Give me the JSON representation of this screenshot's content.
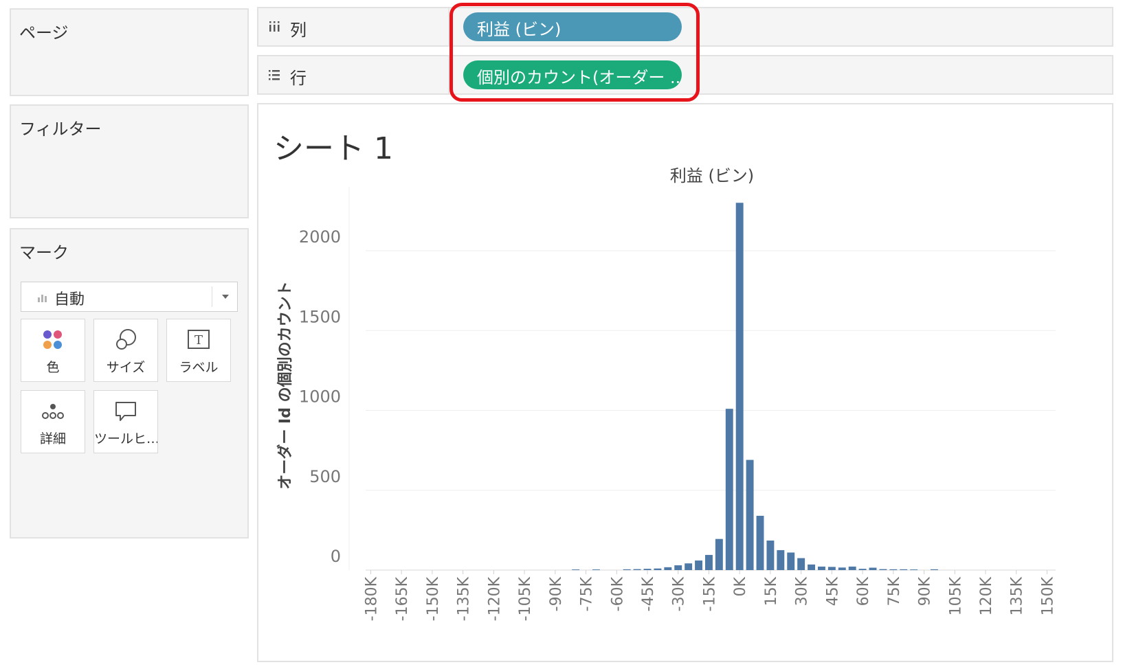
{
  "pages": {
    "title": "ページ"
  },
  "filters": {
    "title": "フィルター"
  },
  "marks": {
    "title": "マーク",
    "mark_type": "自動",
    "cards": [
      {
        "label": "色",
        "icon": "color-dots-icon"
      },
      {
        "label": "サイズ",
        "icon": "size-icon"
      },
      {
        "label": "ラベル",
        "icon": "label-icon"
      },
      {
        "label": "詳細",
        "icon": "detail-icon"
      },
      {
        "label": "ツールヒ…",
        "icon": "tooltip-icon"
      }
    ]
  },
  "shelves": {
    "columns": {
      "label": "列",
      "pill": "利益 (ビン)"
    },
    "rows": {
      "label": "行",
      "pill": "個別のカウント(オーダー .."
    }
  },
  "sheet": {
    "title": "シート 1"
  },
  "colors": {
    "bar": "#4e79a7",
    "column_pill": "#4a98b5",
    "row_pill": "#1bab7a",
    "highlight": "#e8141c"
  },
  "chart_data": {
    "type": "bar",
    "title": "利益 (ビン)",
    "xlabel": "",
    "ylabel": "オーダー Id の個別のカウント",
    "x_ticks": [
      "-180K",
      "-165K",
      "-150K",
      "-135K",
      "-120K",
      "-105K",
      "-90K",
      "-75K",
      "-60K",
      "-45K",
      "-30K",
      "-15K",
      "0K",
      "15K",
      "30K",
      "45K",
      "60K",
      "75K",
      "90K",
      "105K",
      "120K",
      "135K",
      "150K"
    ],
    "y_ticks": [
      0,
      500,
      1000,
      1500,
      2000
    ],
    "ylim": [
      0,
      2400
    ],
    "xlim": [
      -180000,
      150000
    ],
    "bin_width": 5000,
    "bins": [
      {
        "x": -80000,
        "y": 4
      },
      {
        "x": -70000,
        "y": 4
      },
      {
        "x": -55000,
        "y": 5
      },
      {
        "x": -50000,
        "y": 6
      },
      {
        "x": -45000,
        "y": 8
      },
      {
        "x": -40000,
        "y": 10
      },
      {
        "x": -35000,
        "y": 18
      },
      {
        "x": -30000,
        "y": 30
      },
      {
        "x": -25000,
        "y": 42
      },
      {
        "x": -20000,
        "y": 60
      },
      {
        "x": -15000,
        "y": 95
      },
      {
        "x": -10000,
        "y": 195
      },
      {
        "x": -5000,
        "y": 1010
      },
      {
        "x": 0,
        "y": 2300
      },
      {
        "x": 5000,
        "y": 690
      },
      {
        "x": 10000,
        "y": 340
      },
      {
        "x": 15000,
        "y": 185
      },
      {
        "x": 20000,
        "y": 125
      },
      {
        "x": 25000,
        "y": 110
      },
      {
        "x": 30000,
        "y": 75
      },
      {
        "x": 35000,
        "y": 35
      },
      {
        "x": 40000,
        "y": 22
      },
      {
        "x": 45000,
        "y": 20
      },
      {
        "x": 50000,
        "y": 16
      },
      {
        "x": 55000,
        "y": 22
      },
      {
        "x": 60000,
        "y": 8
      },
      {
        "x": 65000,
        "y": 15
      },
      {
        "x": 70000,
        "y": 6
      },
      {
        "x": 75000,
        "y": 5
      },
      {
        "x": 80000,
        "y": 5
      },
      {
        "x": 85000,
        "y": 4
      },
      {
        "x": 95000,
        "y": 5
      }
    ],
    "grid": "horizontal",
    "legend": "none"
  }
}
